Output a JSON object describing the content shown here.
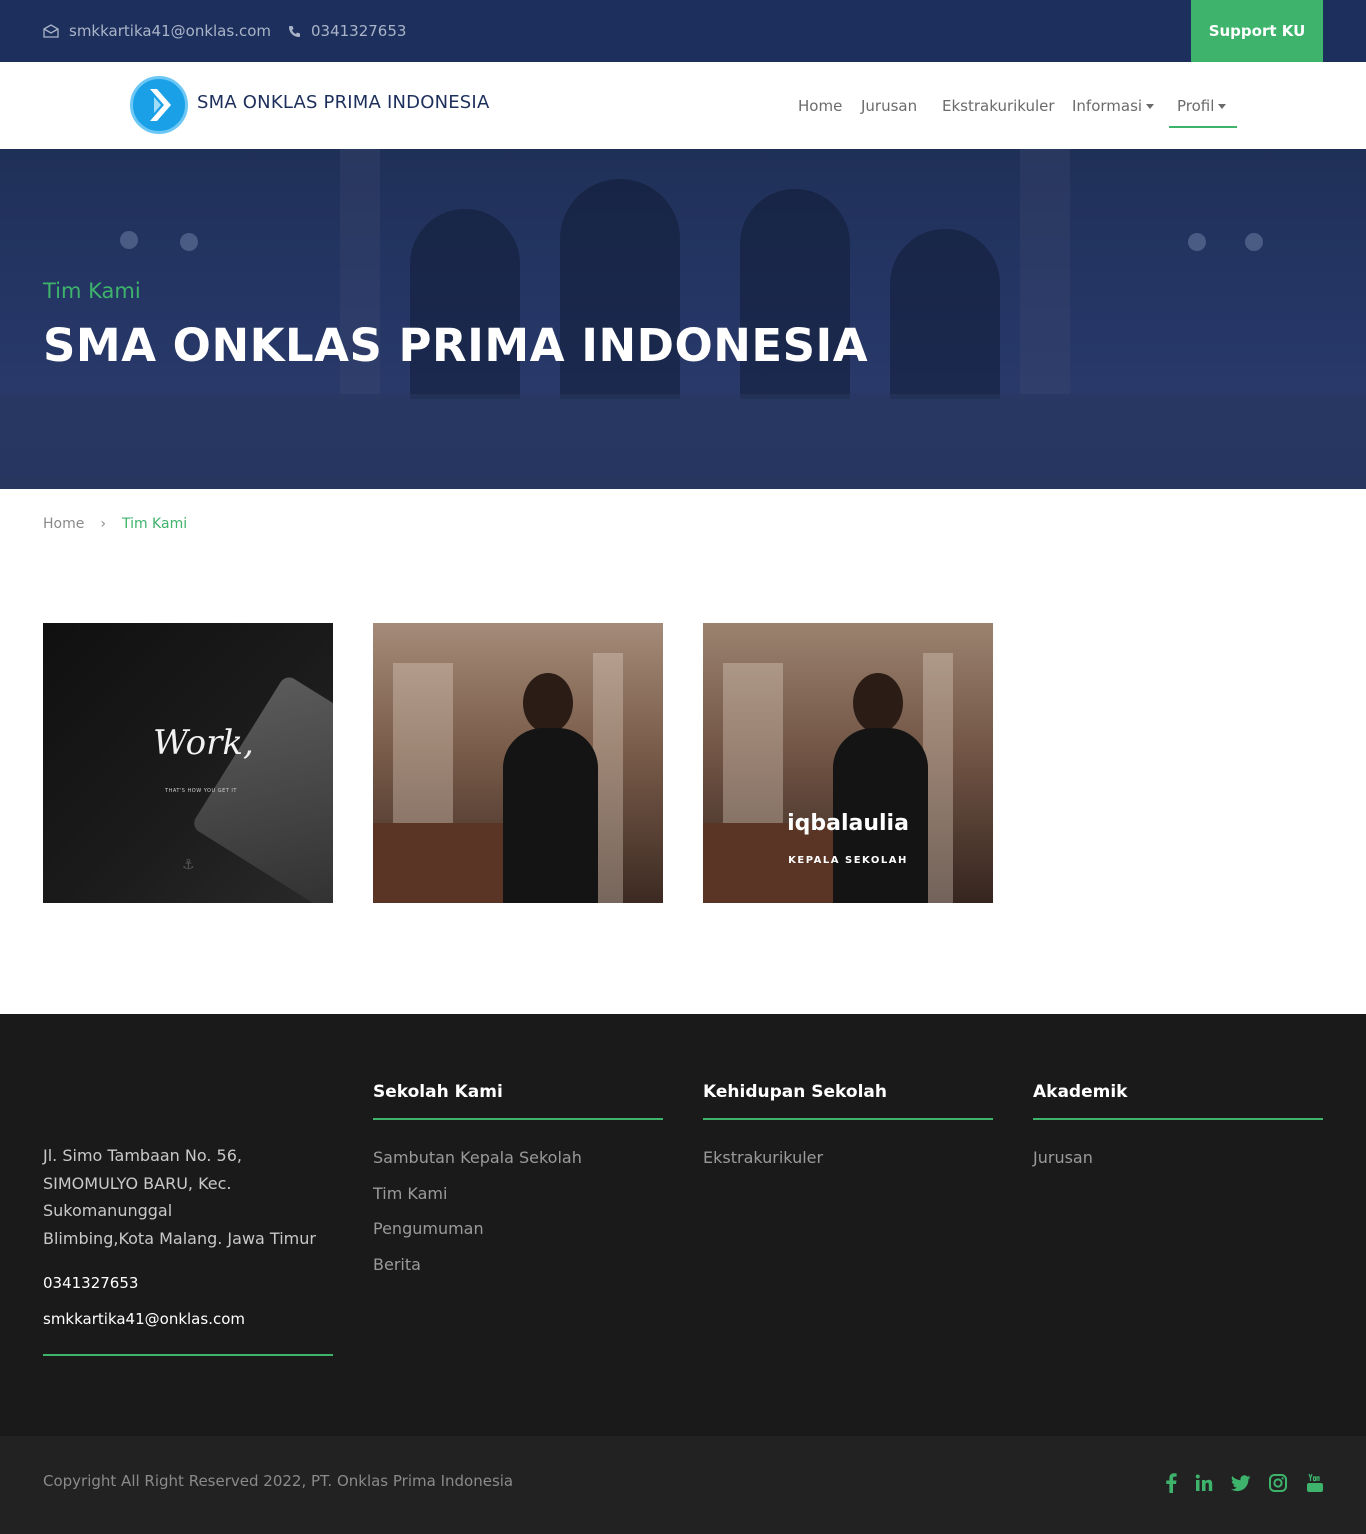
{
  "topbar": {
    "email": "smkkartika41@onklas.com",
    "phone": "0341327653",
    "support_label": "Support KU"
  },
  "navbar": {
    "brand": "SMA ONKLAS PRIMA INDONESIA",
    "items": [
      {
        "label": "Home"
      },
      {
        "label": "Jurusan"
      },
      {
        "label": "Ekstrakurikuler"
      },
      {
        "label": "Informasi"
      },
      {
        "label": "Profil"
      }
    ]
  },
  "hero": {
    "subtitle": "Tim Kami",
    "title": "SMA ONKLAS PRIMA INDONESIA"
  },
  "breadcrumb": {
    "home": "Home",
    "separator": "›",
    "current": "Tim Kami"
  },
  "team": [
    {
      "image_text": "Work,",
      "image_caption": "THAT'S HOW YOU GET IT"
    },
    {},
    {
      "name": "iqbalaulia",
      "role": "KEPALA SEKOLAH"
    }
  ],
  "footer": {
    "address": [
      "Jl. Simo Tambaan No. 56,",
      "SIMOMULYO BARU, Kec.",
      "Sukomanunggal",
      "Blimbing,Kota Malang. Jawa Timur"
    ],
    "phone": "0341327653",
    "email": "smkkartika41@onklas.com",
    "columns": [
      {
        "title": "Sekolah Kami",
        "links": [
          "Sambutan Kepala Sekolah",
          "Tim Kami",
          "Pengumuman",
          "Berita"
        ]
      },
      {
        "title": "Kehidupan Sekolah",
        "links": [
          "Ekstrakurikuler"
        ]
      },
      {
        "title": "Akademik",
        "links": [
          "Jurusan"
        ]
      }
    ],
    "copyright": "Copyright All Right Reserved 2022, PT. Onklas Prima Indonesia",
    "social_icons": [
      "facebook-icon",
      "linkedin-icon",
      "twitter-icon",
      "instagram-icon",
      "youtube-icon"
    ]
  },
  "colors": {
    "navy": "#1d2f5c",
    "accent_green": "#3db36b",
    "footer_bg": "#1a1a1b"
  }
}
